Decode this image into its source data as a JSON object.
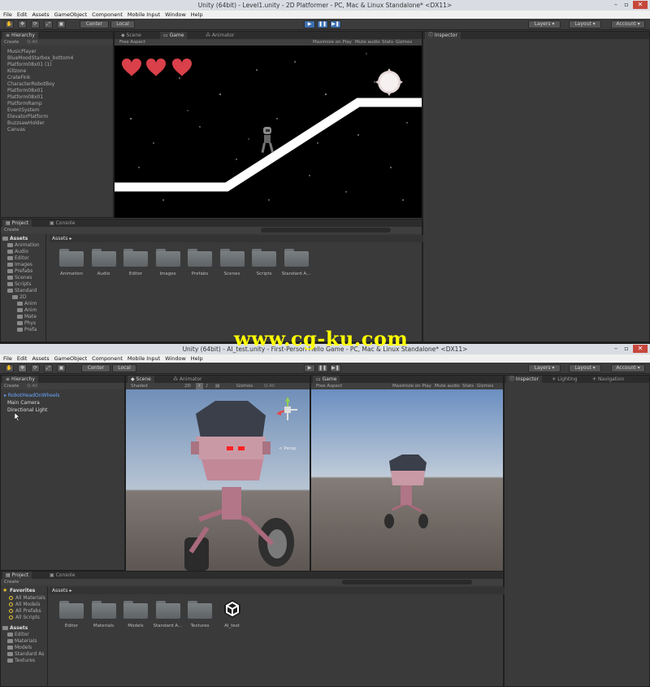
{
  "win1": {
    "title": "Unity (64bit) - Level1.unity - 2D Platformer - PC, Mac & Linux Standalone* <DX11>",
    "menu": [
      "File",
      "Edit",
      "Assets",
      "GameObject",
      "Component",
      "Mobile Input",
      "Window",
      "Help"
    ],
    "toolbar": {
      "center": "Center",
      "local": "Local",
      "layers": "Layers",
      "layout": "Layout",
      "account": "Account"
    },
    "hierarchy": {
      "tab": "Hierarchy",
      "create": "Create",
      "search": "Q·All",
      "items": [
        "MusicPlayer",
        "BlueMoodStarbox_bottom4",
        "Platform08x01 (1)",
        "Killzone",
        "CrateFink",
        "CharacterRobotBoy",
        "Platform08x01",
        "Platform08x01",
        "PlatformRamp",
        "EventSystem",
        "ElevatorPlatform",
        "BuzzsawHolder",
        "Canvas"
      ]
    },
    "scene_tab": "Scene",
    "game_tab": "Game",
    "animator_tab": "Animator",
    "game_bar": {
      "aspect": "Free Aspect",
      "maximize": "Maximize on Play",
      "mute": "Mute audio",
      "stats": "Stats",
      "gizmos": "Gizmos"
    },
    "inspector_tab": "Inspector",
    "project": {
      "tab": "Project",
      "console": "Console",
      "create": "Create",
      "assets_header": "Assets",
      "tree": [
        {
          "label": "Assets",
          "indent": 0,
          "bold": true
        },
        {
          "label": "Animation",
          "indent": 1
        },
        {
          "label": "Audio",
          "indent": 1
        },
        {
          "label": "Editor",
          "indent": 1
        },
        {
          "label": "Images",
          "indent": 1
        },
        {
          "label": "Prefabs",
          "indent": 1
        },
        {
          "label": "Scenes",
          "indent": 1
        },
        {
          "label": "Scripts",
          "indent": 1
        },
        {
          "label": "Standard",
          "indent": 1
        },
        {
          "label": "2D",
          "indent": 2
        },
        {
          "label": "Anim",
          "indent": 3
        },
        {
          "label": "Anim",
          "indent": 3
        },
        {
          "label": "Mate",
          "indent": 3
        },
        {
          "label": "Phys",
          "indent": 3
        },
        {
          "label": "Prefa",
          "indent": 3
        }
      ],
      "folders": [
        "Animation",
        "Audio",
        "Editor",
        "Images",
        "Prefabs",
        "Scenes",
        "Scripts",
        "Standard A..."
      ]
    }
  },
  "win2": {
    "title": "Unity (64bit) - AI_test.unity - First-Person Hello Game - PC, Mac & Linux Standalone* <DX11>",
    "menu": [
      "File",
      "Edit",
      "Assets",
      "GameObject",
      "Component",
      "Mobile Input",
      "Window",
      "Help"
    ],
    "toolbar": {
      "center": "Center",
      "local": "Local",
      "layers": "Layers",
      "layout": "Layout",
      "account": "Account"
    },
    "hierarchy": {
      "tab": "Hierarchy",
      "create": "Create",
      "search": "Q·All",
      "items": [
        "RobotHeadOnWheels",
        "Main Camera",
        "Directional Light"
      ]
    },
    "scene_tab": "Scene",
    "animator_tab": "Animator",
    "scene_bar": {
      "shaded": "Shaded",
      "mode2d": "2D",
      "gizmos": "Gizmos",
      "search": "Q·All"
    },
    "persp": "< Persp",
    "game_tab": "Game",
    "game_bar": {
      "aspect": "Free Aspect",
      "maximize": "Maximize on Play",
      "mute": "Mute audio",
      "stats": "Stats",
      "gizmos": "Gizmos"
    },
    "inspector_tabs": [
      "Inspector",
      "Lighting",
      "Navigation"
    ],
    "project": {
      "tab": "Project",
      "console": "Console",
      "create": "Create",
      "assets_header": "Assets",
      "favorites": {
        "label": "Favorites",
        "items": [
          "All Materials",
          "All Models",
          "All Prefabs",
          "All Scripts"
        ]
      },
      "tree": [
        {
          "label": "Assets",
          "indent": 0,
          "bold": true
        },
        {
          "label": "Editor",
          "indent": 1
        },
        {
          "label": "Materials",
          "indent": 1
        },
        {
          "label": "Models",
          "indent": 1
        },
        {
          "label": "Standard As",
          "indent": 1
        },
        {
          "label": "Textures",
          "indent": 1
        }
      ],
      "folders": [
        "Editor",
        "Materials",
        "Models",
        "Standard A...",
        "Textures"
      ],
      "unity_asset": "AI_test"
    }
  },
  "watermark": "www.cg-ku.com"
}
